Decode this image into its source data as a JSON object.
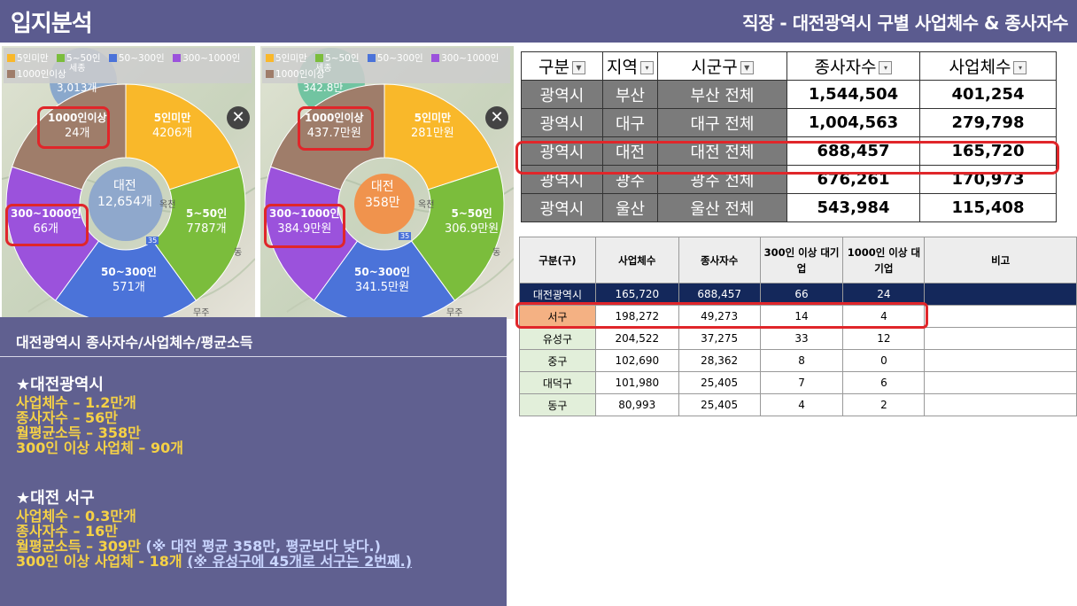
{
  "header": {
    "title": "입지분석",
    "subtitle": "직장 - 대전광역시 구별 사업체수 & 종사자수"
  },
  "colors": {
    "header_bg": "#5b5b8f",
    "seg_lt5": "#f9b82a",
    "seg_5_50": "#7bbd3c",
    "seg_50_300": "#4b73d9",
    "seg_300_1000": "#9b52dc",
    "seg_1000plus": "#9f7d6a",
    "center_left": "#8fa8cc",
    "center_right": "#f0934d",
    "highlight": "#e0262a",
    "total_row": "#14285b",
    "seo_cell": "#f4b183"
  },
  "legend": {
    "items": [
      "5인미만",
      "5~50인",
      "50~300인",
      "300~1000인",
      "1000인이상"
    ]
  },
  "map_left": {
    "top_partial_name": "세종",
    "top_partial_value": "3,013개",
    "center_name": "대전",
    "center_value": "12,654개",
    "segments": [
      {
        "label": "5인미만",
        "value": "4206개"
      },
      {
        "label": "5~50인",
        "value": "7787개"
      },
      {
        "label": "50~300인",
        "value": "571개"
      },
      {
        "label": "300~1000인",
        "value": "66개"
      },
      {
        "label": "1000인이상",
        "value": "24개"
      }
    ],
    "place_labels": [
      "옥천",
      "동",
      "무주",
      "35"
    ]
  },
  "map_right": {
    "top_partial_name": "세종",
    "top_partial_value": "342.8만",
    "center_name": "대전",
    "center_value": "358만",
    "segments": [
      {
        "label": "5인미만",
        "value": "281만원"
      },
      {
        "label": "5~50인",
        "value": "306.9만원"
      },
      {
        "label": "50~300인",
        "value": "341.5만원"
      },
      {
        "label": "300~1000인",
        "value": "384.9만원"
      },
      {
        "label": "1000인이상",
        "value": "437.7만원"
      }
    ],
    "place_labels": [
      "옥천",
      "동",
      "무주",
      "35"
    ]
  },
  "close_symbol": "✕",
  "info": {
    "title": "대전광역시 종사자수/사업체수/평균소득",
    "block1": {
      "heading": "★대전광역시",
      "lines": [
        "사업체수 – 1.2만개",
        "종사자수 – 56만",
        "월평균소득 – 358만",
        "300인 이상 사업체 – 90개"
      ]
    },
    "block2": {
      "heading": "★대전 서구",
      "line1": "사업체수 – 0.3만개",
      "line2": "종사자수 – 16만",
      "line3_main": "월평균소득 – 309만 ",
      "line3_paren": "(※ 대전 평균 358만, 평균보다 낮다.)",
      "line4_main": "300인 이상 사업체 - 18개 ",
      "line4_paren": "(※ 유성구에 45개로 서구는 2번째.)"
    }
  },
  "main_table": {
    "headers": [
      "구분",
      "지역",
      "시군구",
      "종사자수",
      "사업체수"
    ],
    "rows": [
      [
        "광역시",
        "부산",
        "부산 전체",
        "1,544,504",
        "401,254"
      ],
      [
        "광역시",
        "대구",
        "대구 전체",
        "1,004,563",
        "279,798"
      ],
      [
        "광역시",
        "대전",
        "대전 전체",
        "688,457",
        "165,720"
      ],
      [
        "광역시",
        "광주",
        "광주 전체",
        "676,261",
        "170,973"
      ],
      [
        "광역시",
        "울산",
        "울산 전체",
        "543,984",
        "115,408"
      ]
    ]
  },
  "sub_table": {
    "headers": [
      "구분(구)",
      "사업체수",
      "종사자수",
      "300인 이상 대기업",
      "1000인 이상 대기업",
      "비고"
    ],
    "rows": [
      [
        "대전광역시",
        "165,720",
        "688,457",
        "66",
        "24",
        ""
      ],
      [
        "서구",
        "198,272",
        "49,273",
        "14",
        "4",
        ""
      ],
      [
        "유성구",
        "204,522",
        "37,275",
        "33",
        "12",
        ""
      ],
      [
        "중구",
        "102,690",
        "28,362",
        "8",
        "0",
        ""
      ],
      [
        "대덕구",
        "101,980",
        "25,405",
        "7",
        "6",
        ""
      ],
      [
        "동구",
        "80,993",
        "25,405",
        "4",
        "2",
        ""
      ]
    ]
  }
}
